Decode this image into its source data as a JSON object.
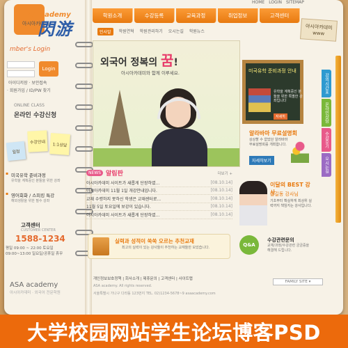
{
  "brand": {
    "name": "ASA cademy",
    "sub": "아시아카데미",
    "watermark": "閃游"
  },
  "toplinks": [
    "HOME",
    "LOGIN",
    "SITEMAP"
  ],
  "tag": {
    "line1": "아시아카데미",
    "line2": "www"
  },
  "nav": [
    "학원소개",
    "수강등록",
    "교육과정",
    "취업정보",
    "고객센터"
  ],
  "subnav": [
    "인사말",
    "학원연혁",
    "학원관리하기",
    "오시는길",
    "학원뉴스"
  ],
  "login": {
    "title": "mber's Login",
    "button": "Login",
    "links": "아이디저장  ·  보안접속",
    "join": "· 회원가입 / ID/PW 찾기"
  },
  "online": {
    "en": "ONLINE CLASS",
    "ko": "온라인 수강신청"
  },
  "stickies": [
    "수강안내",
    "1:1상담",
    "일정"
  ],
  "side": [
    {
      "title": "미국유학 준비과정",
      "desc": "유학을 계획중인 분들을 위한 강좌"
    },
    {
      "title": "영어회화 / 스피킹 특강",
      "desc": "해외생활을 위한 필수 강좌"
    }
  ],
  "cs": {
    "label": "고객센터",
    "sub": "CUSTOMER CENTER",
    "phone": "1588-1234",
    "hours": "평일 09:00 ~ 22:00  토요일 09:00~13:00 일요일/공휴일 휴무"
  },
  "hero": {
    "title_pre": "외국어 정복의 ",
    "title_em": "꿈",
    "title_post": "!",
    "sub": "아시아카데미와 함께 이루세요."
  },
  "chalk": {
    "title": "미국유학 준비과정 안내",
    "text": "유학을 계획중인 분들을 위한 특별한 강좌입니다",
    "btn": "자세히"
  },
  "seminar": {
    "title": "알라바마 무료설명회",
    "text": "상상할 수 없었던 알라바마 무료설명회를 개최합니다.",
    "btn": "자세히보기"
  },
  "rtabs": [
    "강의시간표",
    "온라인상담",
    "수강후기",
    "오시는길"
  ],
  "notice": {
    "badge": "NEWS",
    "title": "알림판",
    "more": "더보기 +",
    "rows": [
      {
        "text": "아시아카데미 사이트가 새롭게 단장하였...",
        "date": "[08.10.14]"
      },
      {
        "text": "아시아카데미 11월 1일 개강안내입니다.",
        "date": "[08.10.14]"
      },
      {
        "text": "교재 수령하지 못하신 학생은 교재센터로...",
        "date": "[08.10.14]"
      },
      {
        "text": "11월 5일 토요일에 보강이 있습니다.",
        "date": "[08.10.14]"
      },
      {
        "text": "아시아카데미 사이트가 새롭게 단장하였...",
        "date": "[08.10.14]"
      }
    ]
  },
  "textbook": {
    "title": "실력과 성적이 쑥쑥 오르는 추천교재",
    "text": "최고의 실력이 있는 강사들이 추천하는 교재들만 모았습니다."
  },
  "teacher": {
    "title": "이달의 BEST 강사",
    "name": "홍길동 강사님",
    "text": "기초부터 확실하게 최상위 실력까지 책임지는 강사입니다."
  },
  "qna": {
    "icon": "Q&A",
    "title": "수강관련문의",
    "text": "교재/과정/수강관련 궁금증을 해결해 드립니다."
  },
  "footer": {
    "logo": "ASA academy",
    "sub": "아시아카데미 · 외국어 전문학원",
    "links": "개인정보보호정책  |  회사소개  |  제휴문의  |  고객센터  |  사이트맵",
    "copy": "ASA academy. All rights reserved.",
    "addr": "서울특별시 가나구 다라동 123번지  TEL. 02)1234-5678~9   asaacademy.com",
    "family": "FAMILY SITE ▾"
  },
  "banner": "大学校园网站学生论坛博客PSD"
}
